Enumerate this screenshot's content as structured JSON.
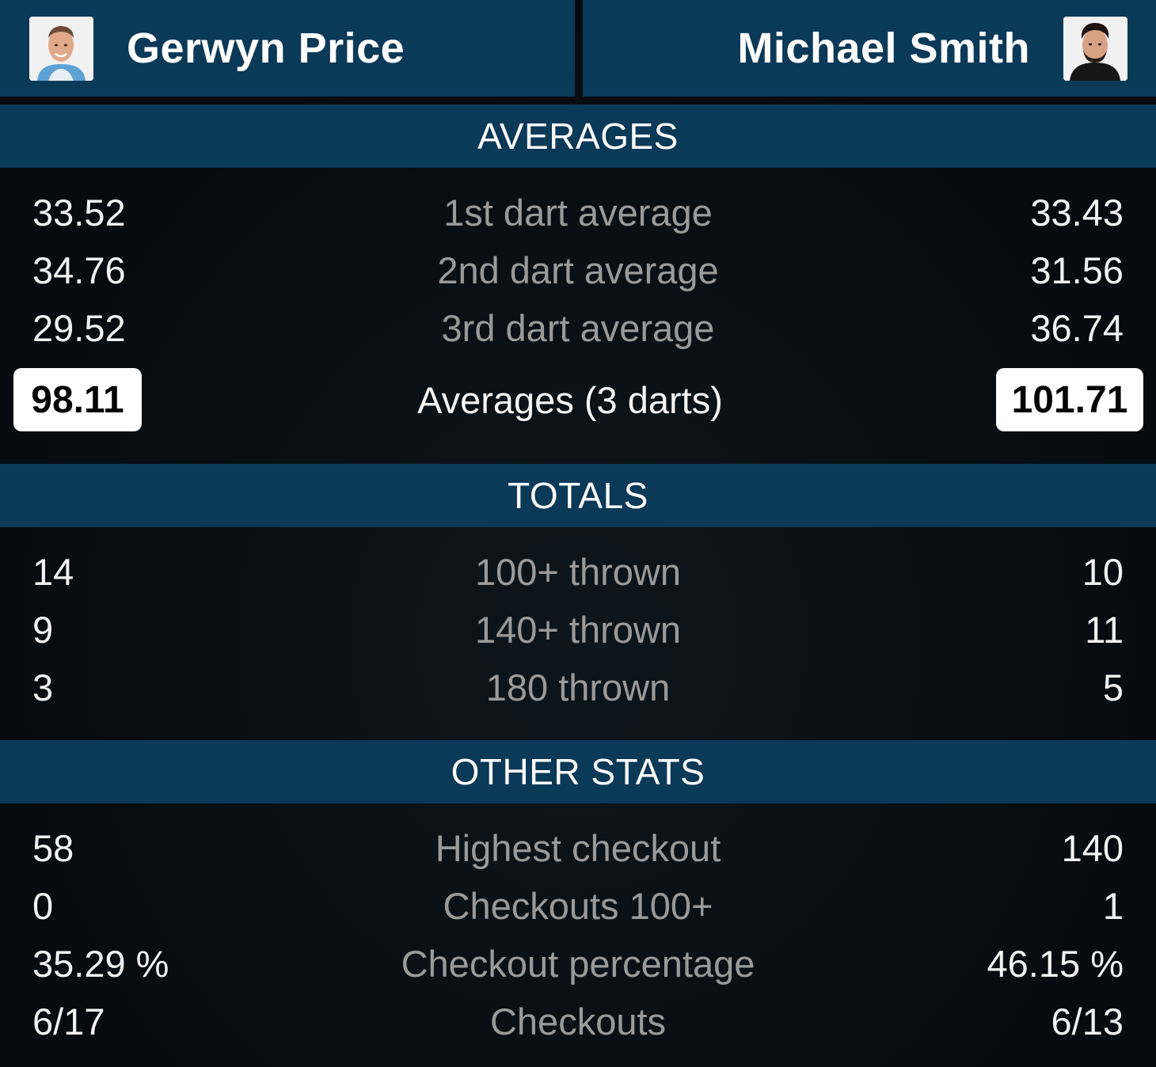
{
  "players": {
    "left": {
      "name": "Gerwyn Price",
      "avatar_icon": "player-photo-icon"
    },
    "right": {
      "name": "Michael Smith",
      "avatar_icon": "player-photo-icon"
    }
  },
  "sections": {
    "averages": {
      "title": "AVERAGES",
      "rows": [
        {
          "label": "1st dart average",
          "left": "33.52",
          "right": "33.43"
        },
        {
          "label": "2nd dart average",
          "left": "34.76",
          "right": "31.56"
        },
        {
          "label": "3rd dart average",
          "left": "29.52",
          "right": "36.74"
        }
      ],
      "total": {
        "label": "Averages (3 darts)",
        "left": "98.11",
        "right": "101.71"
      }
    },
    "totals": {
      "title": "TOTALS",
      "rows": [
        {
          "label": "100+ thrown",
          "left": "14",
          "right": "10"
        },
        {
          "label": "140+ thrown",
          "left": "9",
          "right": "11"
        },
        {
          "label": "180 thrown",
          "left": "3",
          "right": "5"
        }
      ]
    },
    "other": {
      "title": "OTHER STATS",
      "rows": [
        {
          "label": "Highest checkout",
          "left": "58",
          "right": "140"
        },
        {
          "label": "Checkouts 100+",
          "left": "0",
          "right": "1"
        },
        {
          "label": "Checkout percentage",
          "left": "35.29 %",
          "right": "46.15 %"
        },
        {
          "label": "Checkouts",
          "left": "6/17",
          "right": "6/13"
        }
      ]
    }
  },
  "colors": {
    "header_bg": "#0b3958",
    "body_bg": "#070c10",
    "label_text": "#9a9a9a",
    "value_text": "#f2f2f2"
  }
}
